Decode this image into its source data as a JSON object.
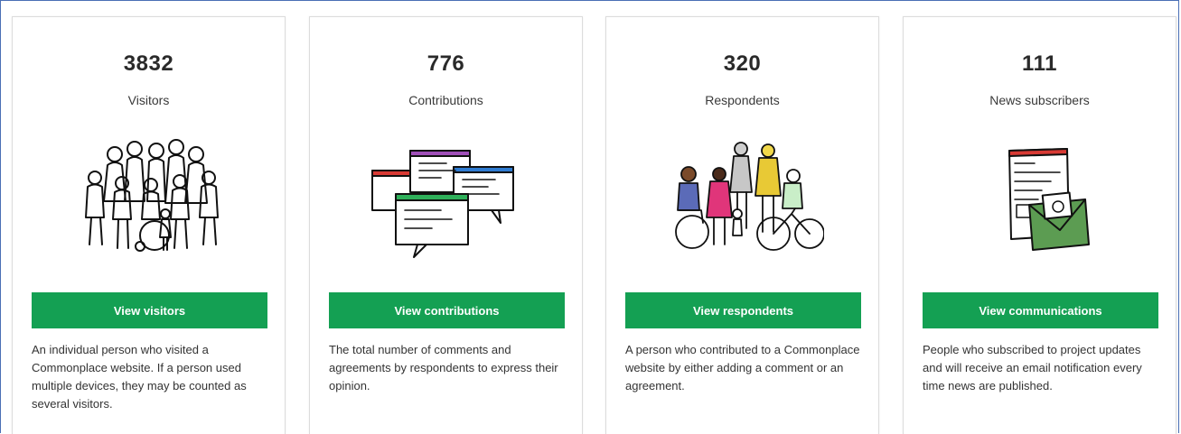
{
  "colors": {
    "accent": "#14a053",
    "frame": "#4a6fb5"
  },
  "cards": [
    {
      "count": "3832",
      "label": "Visitors",
      "icon": "crowd-of-people-illustration",
      "button": "View visitors",
      "description": "An individual person who visited a Commonplace website. If a person used multiple devices, they may be counted as several visitors."
    },
    {
      "count": "776",
      "label": "Contributions",
      "icon": "comment-windows-illustration",
      "button": "View contributions",
      "description": "The total number of comments and agreements by respondents to express their opinion."
    },
    {
      "count": "320",
      "label": "Respondents",
      "icon": "diverse-respondents-illustration",
      "button": "View respondents",
      "description": "A person who contributed to a Commonplace website by either adding a comment or an agreement."
    },
    {
      "count": "111",
      "label": "News subscribers",
      "icon": "newsletter-envelope-illustration",
      "button": "View communications",
      "description": "People who subscribed to project updates and will receive an email notification every time news are published."
    }
  ]
}
